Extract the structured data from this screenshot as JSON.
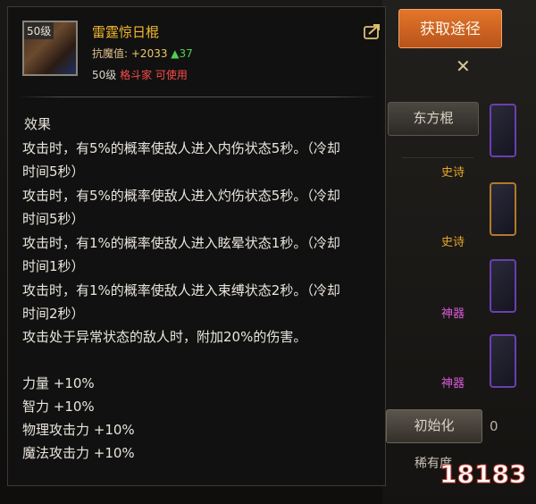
{
  "item": {
    "level_badge": "50级",
    "name": "雷霆惊日棍",
    "magic_label": "抗魔值:",
    "magic_value": "+2033",
    "magic_delta": "▲37",
    "req_level": "50级",
    "req_class": "格斗家 可使用"
  },
  "effects": {
    "title": "效果",
    "lines": [
      "攻击时，有5%的概率使敌人进入内伤状态5秒。（冷却",
      "时间5秒）",
      "攻击时，有5%的概率使敌人进入灼伤状态5秒。（冷却",
      "时间5秒）",
      "攻击时，有1%的概率使敌人进入眩晕状态1秒。（冷却",
      "时间1秒）",
      "攻击时，有1%的概率使敌人进入束缚状态2秒。（冷却",
      "时间2秒）",
      "攻击处于异常状态的敌人时，附加20%的伤害。"
    ]
  },
  "stats": [
    "力量 +10%",
    "智力 +10%",
    "物理攻击力 +10%",
    "魔法攻击力 +10%"
  ],
  "buttons": {
    "get_source": "获取途径"
  },
  "right_panel": {
    "tab": "东方棍",
    "grades": [
      "史诗",
      "史诗",
      "神器",
      "神器"
    ],
    "init_button": "初始化",
    "rarity": "稀有度",
    "partial_number": "0"
  },
  "colors": {
    "legendary": "#f5b92f",
    "epic": "#e6a52a",
    "artifact": "#d65ad6",
    "accent": "#e3762a"
  },
  "watermark": "18183"
}
